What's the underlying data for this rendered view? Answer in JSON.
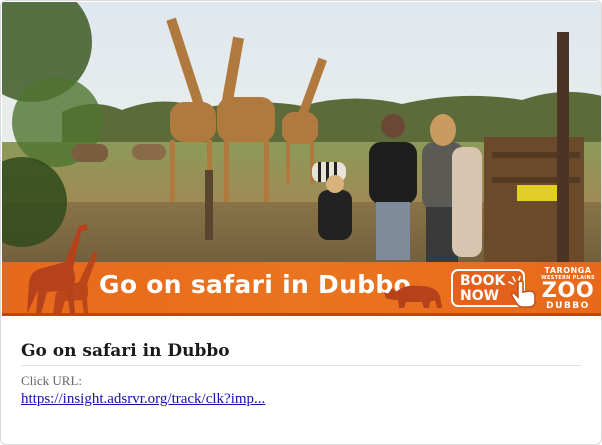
{
  "ad": {
    "banner_headline": "Go on safari in Dubbo",
    "cta": {
      "line1": "BOOK",
      "line2": "NOW"
    },
    "logo": {
      "line1": "TARONGA",
      "line2": "WESTERN PLAINS",
      "main": "ZOO",
      "line3": "DUBBO"
    },
    "colors": {
      "banner": "#ea741f",
      "banner_edge": "#b84a10",
      "silhouette": "#b5421a"
    },
    "icons": [
      "giraffe-silhouette-icon",
      "rhino-silhouette-icon",
      "hand-pointer-icon"
    ]
  },
  "card": {
    "title": "Go on safari in Dubbo",
    "click_url_label": "Click URL:",
    "click_url": "https://insight.adsrvr.org/track/clk?imp..."
  }
}
